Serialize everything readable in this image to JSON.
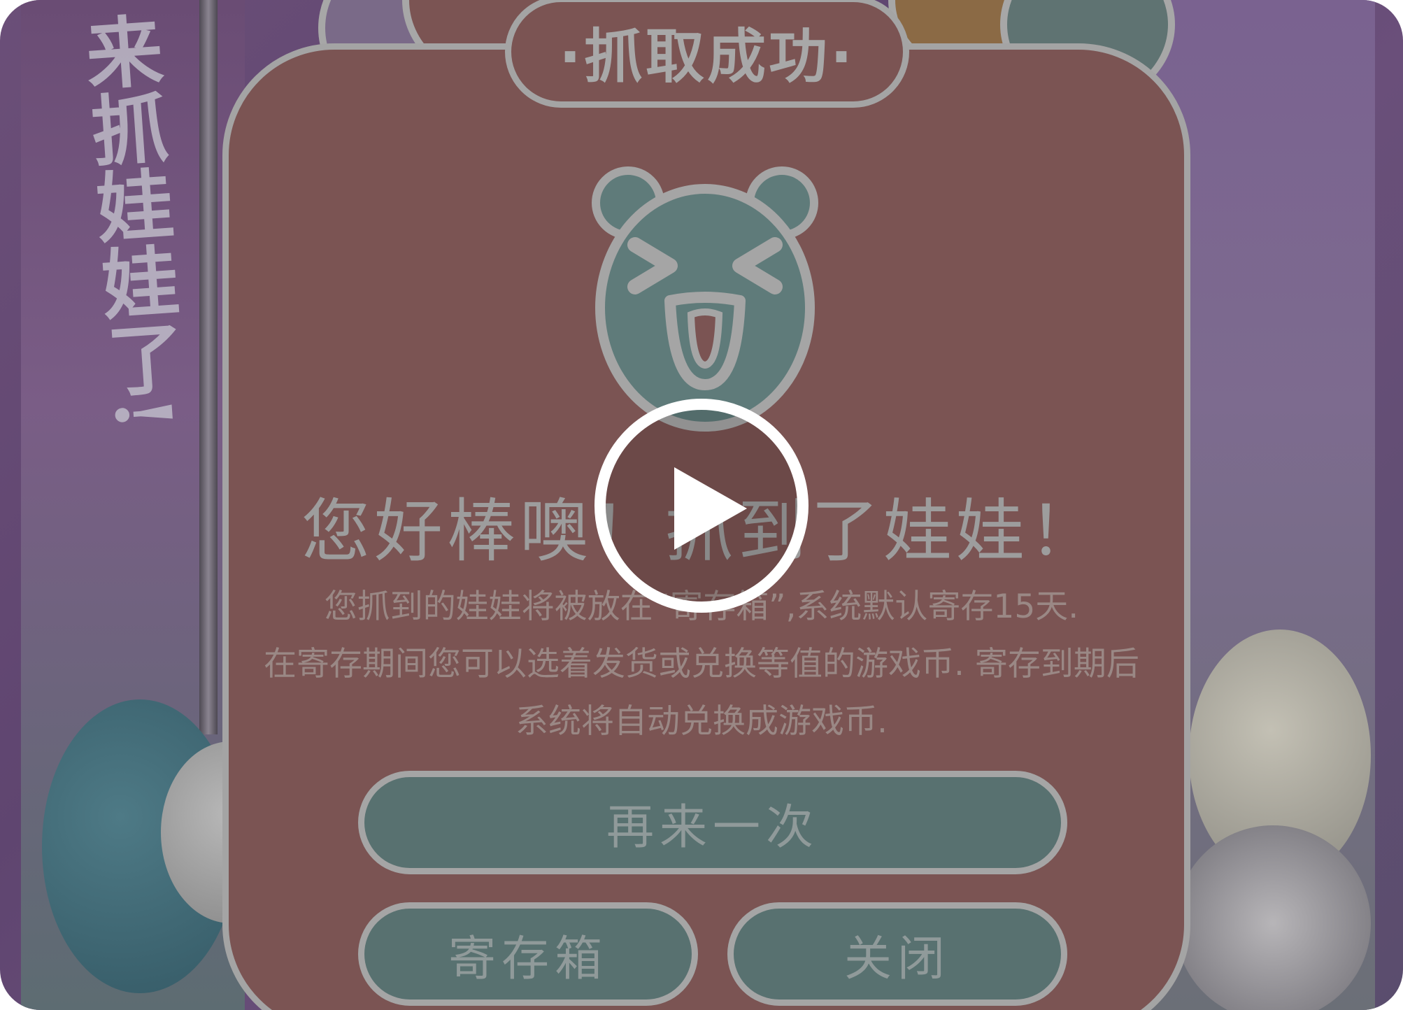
{
  "dialog": {
    "title": "·抓取成功·",
    "headline": "您好棒噢！抓到了娃娃！",
    "description_lines": [
      "您抓到的娃娃将被放在“寄存箱”,系统默认寄存15天.",
      "在寄存期间您可以选着发货或兑换等值的游戏币. 寄存到期后",
      "系统将自动兑换成游戏币."
    ],
    "buttons": {
      "retry": "再来一次",
      "storage": "寄存箱",
      "close": "关闭"
    }
  },
  "background": {
    "left_text": "来抓娃娃了!"
  },
  "icons": {
    "mascot": "bear-face-icon",
    "play": "play-icon"
  },
  "colors": {
    "dialog_fill": "#7b5453",
    "button_fill": "#587170",
    "border": "#a4a4a4",
    "mascot": "#5f7b7a"
  }
}
